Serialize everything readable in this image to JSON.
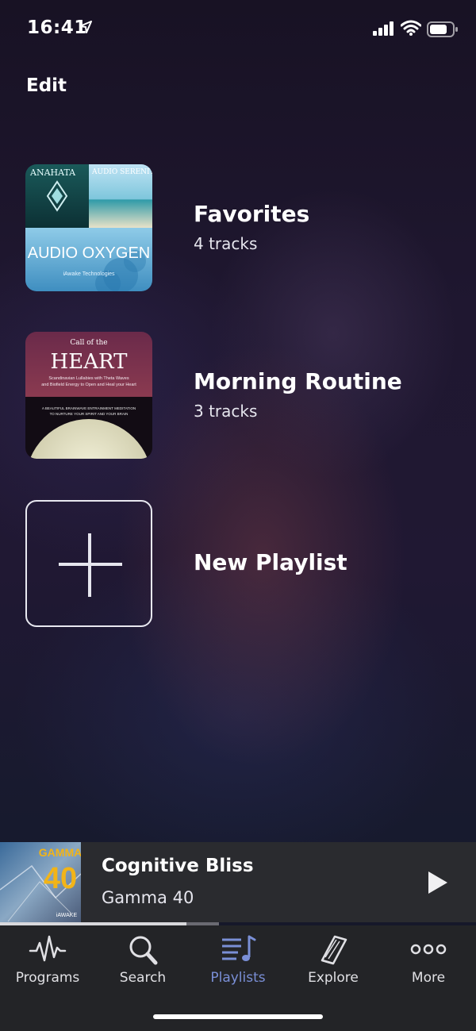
{
  "status": {
    "time": "16:41"
  },
  "header": {
    "edit_label": "Edit"
  },
  "playlists": [
    {
      "title": "Favorites",
      "subtitle": "4 tracks",
      "cover": {
        "tl": "ANAHATA",
        "tr": "AUDIO SERENITY",
        "bottom": "AUDIO OXYGEN",
        "bottom_small": "iAwake Technologies"
      }
    },
    {
      "title": "Morning Routine",
      "subtitle": "3 tracks",
      "cover": {
        "top_small": "Call of the",
        "title": "HEART",
        "line1": "Scandinavian Lullabies with Theta Waves",
        "line2": "and Biofield Energy to Open and Heal your Heart",
        "line3": "A BEAUTIFUL BRAINWAVE ENTRAINMENT MEDITATION",
        "line4": "TO NURTURE YOUR SPIRIT AND YOUR BRAIN"
      }
    }
  ],
  "new_playlist": {
    "label": "New Playlist"
  },
  "now_playing": {
    "title": "Cognitive Bliss",
    "subtitle": "Gamma 40",
    "art_text": "GAMMA",
    "art_num": "40",
    "art_brand": "iAWAKE",
    "progress": 0.85
  },
  "tabs": [
    {
      "label": "Programs",
      "icon": "waveform-icon"
    },
    {
      "label": "Search",
      "icon": "search-icon"
    },
    {
      "label": "Playlists",
      "icon": "playlists-icon",
      "active": true
    },
    {
      "label": "Explore",
      "icon": "book-icon"
    },
    {
      "label": "More",
      "icon": "more-icon"
    }
  ],
  "colors": {
    "accent": "#7a8fd6",
    "mini_player_bg": "#2a2b2f",
    "tabbar_bg": "#232427"
  }
}
